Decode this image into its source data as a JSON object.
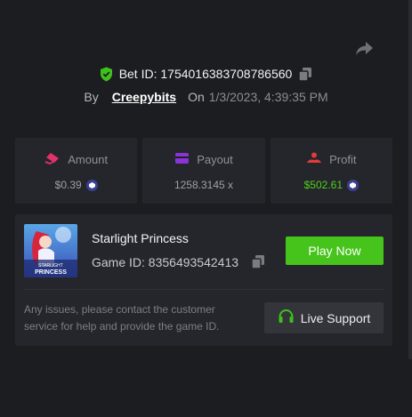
{
  "bet": {
    "id_label": "Bet ID: 1754016383708786560",
    "by_label": "By",
    "username": "Creepybits",
    "on_label": "On",
    "date": "1/3/2023, 4:39:35 PM"
  },
  "stats": {
    "amount": {
      "label": "Amount",
      "value": "$0.39",
      "icon": "bet-amount-icon",
      "icon_color": "#e2326b"
    },
    "payout": {
      "label": "Payout",
      "value": "1258.3145 x",
      "icon": "wallet-icon",
      "icon_color": "#8a33d6"
    },
    "profit": {
      "label": "Profit",
      "value": "$502.61",
      "icon": "profit-icon",
      "icon_color": "#e23b3b",
      "value_color": "#4ed21a"
    }
  },
  "game": {
    "name": "Starlight Princess",
    "id_label": "Game ID: 8356493542413",
    "thumb_text": [
      "STARLIGHT",
      "PRINCESS"
    ],
    "play_label": "Play Now"
  },
  "support": {
    "help_text": "Any issues, please contact the customer service for help and provide the game ID.",
    "button_label": "Live Support"
  },
  "colors": {
    "accent_green": "#46c41b",
    "shield_green": "#3ec21a",
    "background": "#1c1d21",
    "card": "#25262b"
  }
}
